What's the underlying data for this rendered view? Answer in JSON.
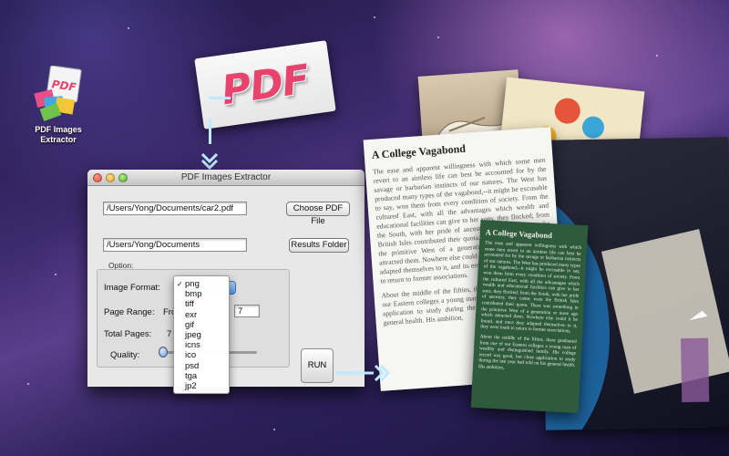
{
  "desktop_icon": {
    "label_line1": "PDF Images",
    "label_line2": "Extractor"
  },
  "pdf_card": {
    "text": "PDF"
  },
  "window": {
    "title": "PDF Images Extractor",
    "pdf_path": "/Users/Yong/Documents/car2.pdf",
    "choose_pdf_label": "Choose PDF File",
    "results_path": "/Users/Yong/Documents",
    "results_folder_label": "Results Folder",
    "option_label": "Option:",
    "image_format_label": "Image Format:",
    "page_range_label": "Page Range:",
    "page_range_from_fragment": "Fro",
    "page_range_to_value": "7",
    "total_pages_label": "Total Pages:",
    "total_pages_value": "7",
    "quality_label": "Quality:",
    "run_label": "RUN"
  },
  "format_menu": {
    "selected": "png",
    "options": [
      "png",
      "bmp",
      "tiff",
      "exr",
      "gif",
      "jpeg",
      "icns",
      "ico",
      "psd",
      "tga",
      "jp2"
    ]
  },
  "doc_page": {
    "title": "A College Vagabond",
    "paragraph1": "The ease and apparent willingness with which some men revert to an aimless life can best be accounted for by the savage or barbarian instincts of our natures. The West has produced many types of the vagabond,--it might be excusable to say, won them from every condition of society. From the cultured East, with all the advantages which wealth and educational facilities can give to her sons, they flocked; from the South, with her pride of ancestry, they came; even the British Isles contributed their quota. There was something in the primitive West of a generation or more ago which attracted them. Nowhere else could it be found, and once they adapted themselves to it, and its environment, they were loath to return to former associations.",
    "paragraph2": "About the middle of the fifties, there graduated from one of our Eastern colleges a young man of wealthy good, but close application to study during the last year had told on his general health. His ambition,"
  },
  "green_page": {
    "title": "A College Vagabond",
    "paragraph1": "The ease and apparent willingness with which some men revert to an aimless life can best be accounted for by the savage or barbarian instincts of our natures. The West has produced many types of the vagabond,--it might be excusable to say, won them from every condition of society. From the cultured East, with all the advantages which wealth and educational facilities can give to her sons, they flocked; from the South, with her pride of ancestry, they came; even the British Isles contributed their quota. There was something in the primitive West of a generation or more ago which attracted them. Nowhere else could it be found, and once they adapted themselves to it, they were loath to return to former associations.",
    "paragraph2": "About the middle of the fifties, there graduated from one of our Eastern colleges a young man of wealthy and distinguished family. His college record was good, but close application to study during the last year had told on his general health. His ambition,"
  },
  "colors": {
    "accent_blue": "#5c9be6",
    "pdf_pink": "#e8436d",
    "green_page": "#2d5b3c",
    "pointer": "#bfe9ff"
  }
}
